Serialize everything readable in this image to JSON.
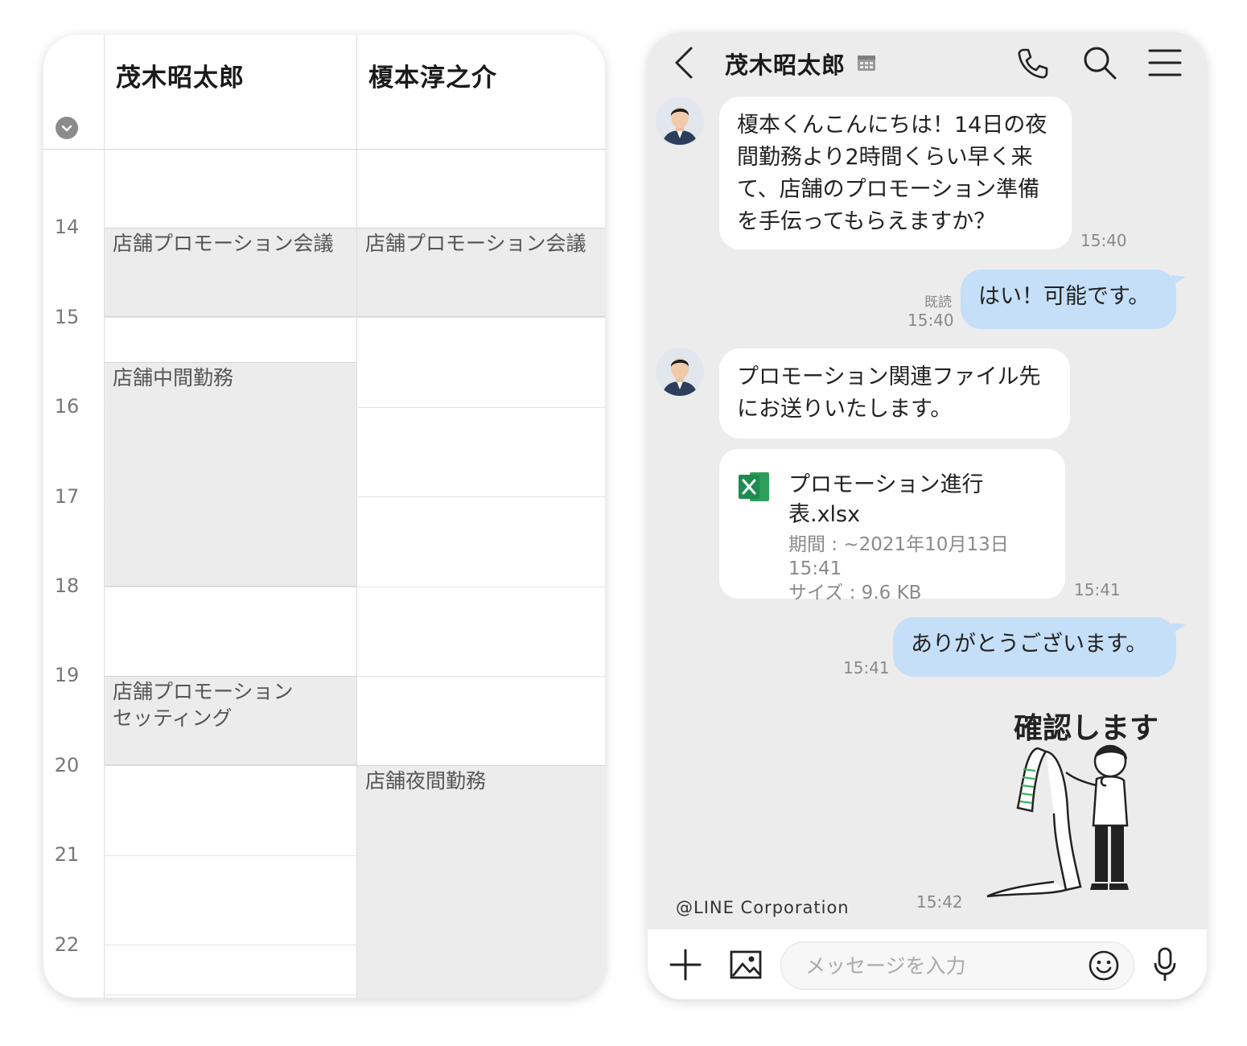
{
  "schedule": {
    "people": [
      "茂木昭太郎",
      "榎本淳之介"
    ],
    "hours": [
      "14",
      "15",
      "16",
      "17",
      "18",
      "19",
      "20",
      "21",
      "22"
    ],
    "events": {
      "p1_meeting": "店舗プロモーション会議",
      "p1_midshift": "店舗中間勤務",
      "p1_setting": "店舗プロモーション\nセッティング",
      "p2_meeting": "店舗プロモーション会議",
      "p2_nightshift": "店舗夜間勤務"
    }
  },
  "chat": {
    "title": "茂木昭太郎",
    "messages": {
      "m1_text": "榎本くんこんにちは！14日の夜間勤務より2時間くらい早く来て、店舗のプロモーション準備を手伝ってもらえますか？",
      "m1_time": "15:40",
      "m2_text": "はい！可能です。",
      "m2_read": "既読",
      "m2_time": "15:40",
      "m3_text": "プロモーション関連ファイル先にお送りいたします。",
      "file_name": "プロモーション進行表.xlsx",
      "file_period": "期間 : ~2021年10月13日 15:41",
      "file_size": "サイズ : 9.6 KB",
      "file_time": "15:41",
      "m4_text": "ありがとうございます。",
      "m4_time": "15:41",
      "sticker_text": "確認します",
      "sticker_time": "15:42"
    },
    "copyright": "@LINE Corporation",
    "input_placeholder": "メッセージを入力"
  },
  "colors": {
    "my_bubble": "#c5dff8",
    "other_bubble": "#ffffff",
    "chat_bg": "#ececec",
    "event_bg": "#ececec",
    "excel_green": "#1e8c4e"
  }
}
